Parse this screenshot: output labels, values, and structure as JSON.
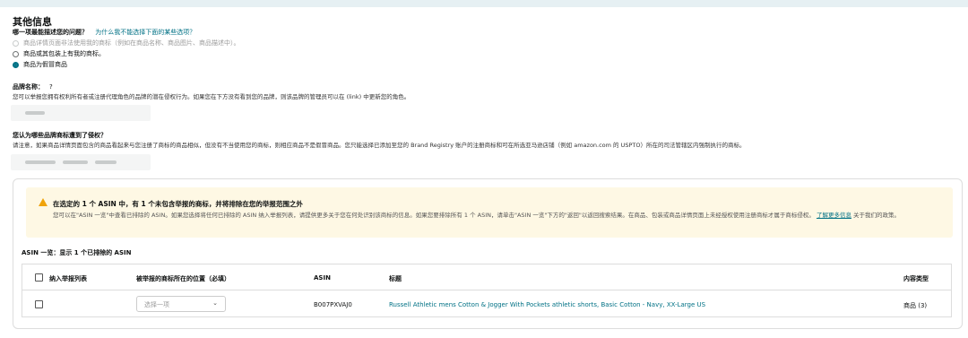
{
  "section": {
    "title": "其他信息"
  },
  "question": {
    "text": "哪一项最能描述您的问题？",
    "link": "为什么我不能选择下面的某些选项？",
    "options": [
      {
        "label": "商品详情页面非法使用我的商标（例如在商品名称、商品图片、商品描述中）。",
        "state": "disabled"
      },
      {
        "label": "商品或其包装上有我的商标。",
        "state": "unchecked"
      },
      {
        "label": "商品为假冒商品",
        "state": "checked"
      }
    ]
  },
  "brand": {
    "label": "品牌名称：",
    "tooltip": "?",
    "description": "您可以举报您拥有权利所有者或注册代理角色的品牌的潜在侵权行为。如果您在下方没有看到您的品牌，则该品牌的管理员可以在 (link) 中更新您的角色。"
  },
  "trademark": {
    "label": "您认为哪些品牌商标遭到了侵权？",
    "description": "请注意，如果商品详情页面包含的商品看起来与您注册了商标的商品相似，但没有不当使用您的商标，则相应商品不是假冒商品。您只能选择已添加至您的 Brand Registry 账户的注册商标和可在所选亚马逊店铺（例如 amazon.com 的 USPTO）所在的司法管辖区内强制执行的商标。"
  },
  "alert": {
    "title": "在选定的 1 个 ASIN 中，有 1 个未包含举报的商标，并将排除在您的举报范围之外",
    "body": "您可以在\"ASIN 一览\"中查看已排除的 ASIN。如果您选择将任何已排除的 ASIN 纳入举报列表，请提供更多关于您在何处识别该商标的信息。如果您要排除所有 1 个 ASIN，请单击\"ASIN 一览\"下方的\"返回\"以返回搜索结果。在商品、包装或商品详情页面上未经授权使用注册商标才属于商标侵权。",
    "link": "了解更多信息",
    "tail": "关于我们的政策。"
  },
  "asin_list": {
    "caption": "ASIN 一览：显示 1 个已排除的 ASIN",
    "columns": [
      "纳入举报列表",
      "被举报的商标所在的位置（必填）",
      "ASIN",
      "标题",
      "内容类型"
    ],
    "rows": [
      {
        "location_placeholder": "选择一项",
        "asin": "B007PXVAJ0",
        "title": "Russell Athletic mens Cotton & Jogger With Pockets athletic shorts, Basic Cotton - Navy, XX-Large US",
        "content_type": "商品 (3)"
      }
    ]
  }
}
